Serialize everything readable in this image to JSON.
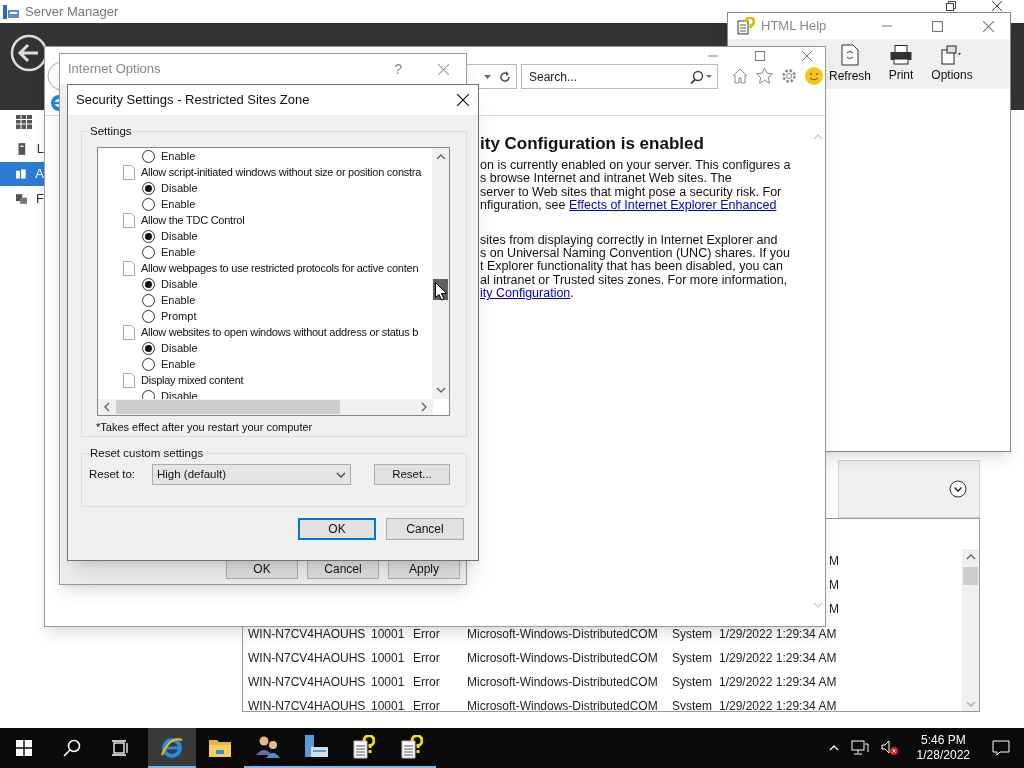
{
  "server_manager": {
    "title": "Server Manager",
    "sidebar": [
      {
        "kind": "dashboard",
        "selected": false
      },
      {
        "kind": "server",
        "label": "L",
        "selected": false
      },
      {
        "kind": "servers",
        "label": "A",
        "selected": true
      },
      {
        "kind": "storage",
        "label": "F",
        "selected": false
      }
    ],
    "events": {
      "cut_cells": [
        "M",
        "M",
        "M"
      ],
      "rows": [
        [
          "WIN-N7CV4HAOUHS",
          "10001",
          "Error",
          "Microsoft-Windows-DistributedCOM",
          "System",
          "1/29/2022 1:29:34 AM"
        ],
        [
          "WIN-N7CV4HAOUHS",
          "10001",
          "Error",
          "Microsoft-Windows-DistributedCOM",
          "System",
          "1/29/2022 1:29:34 AM"
        ],
        [
          "WIN-N7CV4HAOUHS",
          "10001",
          "Error",
          "Microsoft-Windows-DistributedCOM",
          "System",
          "1/29/2022 1:29:34 AM"
        ],
        [
          "WIN-N7CV4HAOUHS",
          "10001",
          "Error",
          "Microsoft-Windows-DistributedCOM",
          "Svstem",
          "1/29/2022 1:29:34 AM"
        ]
      ]
    }
  },
  "html_help": {
    "title": "HTML Help",
    "toolbar": [
      {
        "kind": "refresh",
        "label": "Refresh"
      },
      {
        "kind": "print",
        "label": "Print"
      },
      {
        "kind": "options",
        "label": "Options"
      }
    ]
  },
  "browser": {
    "search": {
      "placeholder": "Search..."
    },
    "heading": "ity Configuration is enabled",
    "paragraphs": [
      [
        [
          {
            "kind": "text",
            "text": "on is currently enabled on your server. This configures a"
          }
        ],
        [
          {
            "kind": "text",
            "text": "s browse Internet and intranet Web sites. The"
          }
        ],
        [
          {
            "kind": "text",
            "text": "server to Web sites that might pose a security risk. For"
          }
        ],
        [
          {
            "kind": "text",
            "text": "nfiguration, see "
          },
          {
            "kind": "link",
            "text": "Effects of Internet Explorer Enhanced"
          }
        ]
      ],
      [
        [
          {
            "kind": "text",
            "text": "sites from displaying correctly in Internet Explorer and"
          }
        ],
        [
          {
            "kind": "text",
            "text": "s on Universal Naming Convention (UNC) shares. If you"
          }
        ],
        [
          {
            "kind": "text",
            "text": "t Explorer functionality that has been disabled, you can"
          }
        ],
        [
          {
            "kind": "text",
            "text": "al intranet or Trusted sites zones. For more information,"
          }
        ],
        [
          {
            "kind": "link",
            "text": "ity Configuration"
          },
          {
            "kind": "text",
            "text": "."
          }
        ]
      ]
    ]
  },
  "internet_options": {
    "title": "Internet Options",
    "help": "?",
    "buttons": [
      "OK",
      "Cancel",
      "Apply"
    ]
  },
  "security_settings": {
    "title": "Security Settings - Restricted Sites Zone",
    "settings_label": "Settings",
    "items": [
      {
        "kind": "option",
        "label": "Enable",
        "selected": false
      },
      {
        "kind": "setting",
        "label": "Allow script-initiated windows without size or position constra"
      },
      {
        "kind": "option",
        "label": "Disable",
        "selected": true
      },
      {
        "kind": "option",
        "label": "Enable",
        "selected": false
      },
      {
        "kind": "setting",
        "label": "Allow the TDC Control"
      },
      {
        "kind": "option",
        "label": "Disable",
        "selected": true
      },
      {
        "kind": "option",
        "label": "Enable",
        "selected": false
      },
      {
        "kind": "setting",
        "label": "Allow webpages to use restricted protocols for active conten"
      },
      {
        "kind": "option",
        "label": "Disable",
        "selected": true
      },
      {
        "kind": "option",
        "label": "Enable",
        "selected": false
      },
      {
        "kind": "option",
        "label": "Prompt",
        "selected": false
      },
      {
        "kind": "setting",
        "label": "Allow websites to open windows without address or status b"
      },
      {
        "kind": "option",
        "label": "Disable",
        "selected": true
      },
      {
        "kind": "option",
        "label": "Enable",
        "selected": false
      },
      {
        "kind": "setting",
        "label": "Display mixed content"
      },
      {
        "kind": "option",
        "label": "Disable",
        "selected": false
      }
    ],
    "note": "*Takes effect after you restart your computer",
    "reset_group": "Reset custom settings",
    "reset_label": "Reset to:",
    "reset_value": "High (default)",
    "reset_button": "Reset...",
    "buttons": [
      {
        "label": "OK",
        "default": true
      },
      {
        "label": "Cancel",
        "default": false
      }
    ]
  },
  "taskbar": {
    "apps": [
      {
        "kind": "start",
        "running": false,
        "active": false
      },
      {
        "kind": "search",
        "running": false,
        "active": false
      },
      {
        "kind": "taskview",
        "running": false,
        "active": false
      },
      {
        "kind": "browser",
        "running": true,
        "active": true
      },
      {
        "kind": "folder",
        "running": false,
        "active": false
      },
      {
        "kind": "users",
        "running": true,
        "active": false
      },
      {
        "kind": "server",
        "running": true,
        "active": false
      },
      {
        "kind": "help",
        "running": true,
        "active": false
      },
      {
        "kind": "help",
        "running": true,
        "active": false
      }
    ],
    "time": "5:46 PM",
    "date": "1/28/2022"
  }
}
